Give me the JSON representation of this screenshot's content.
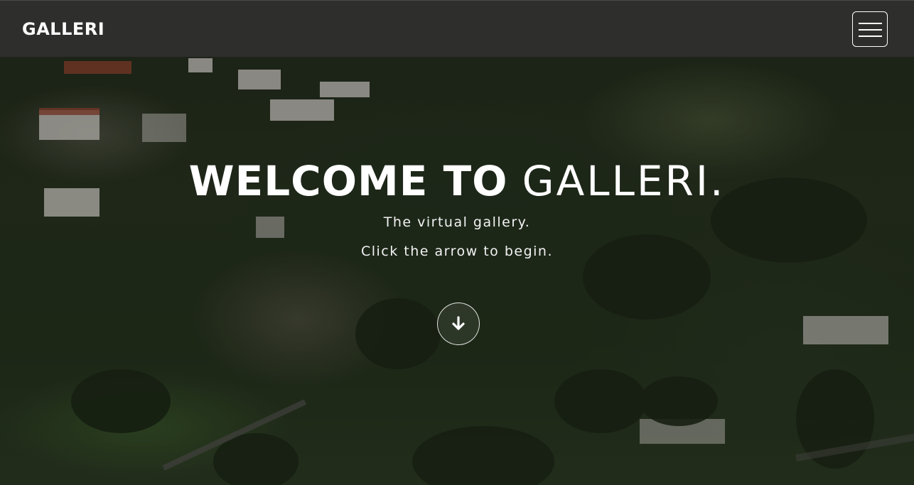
{
  "navbar": {
    "brand": "GALLERI",
    "menu_icon": "hamburger-menu-icon"
  },
  "hero": {
    "title_bold": "WELCOME TO",
    "title_light": "GALLERI.",
    "subtitle": "The virtual gallery.",
    "instruction": "Click the arrow to begin.",
    "scroll_icon": "arrow-down-icon"
  },
  "colors": {
    "navbar_bg": "#303030",
    "text": "#ffffff"
  }
}
